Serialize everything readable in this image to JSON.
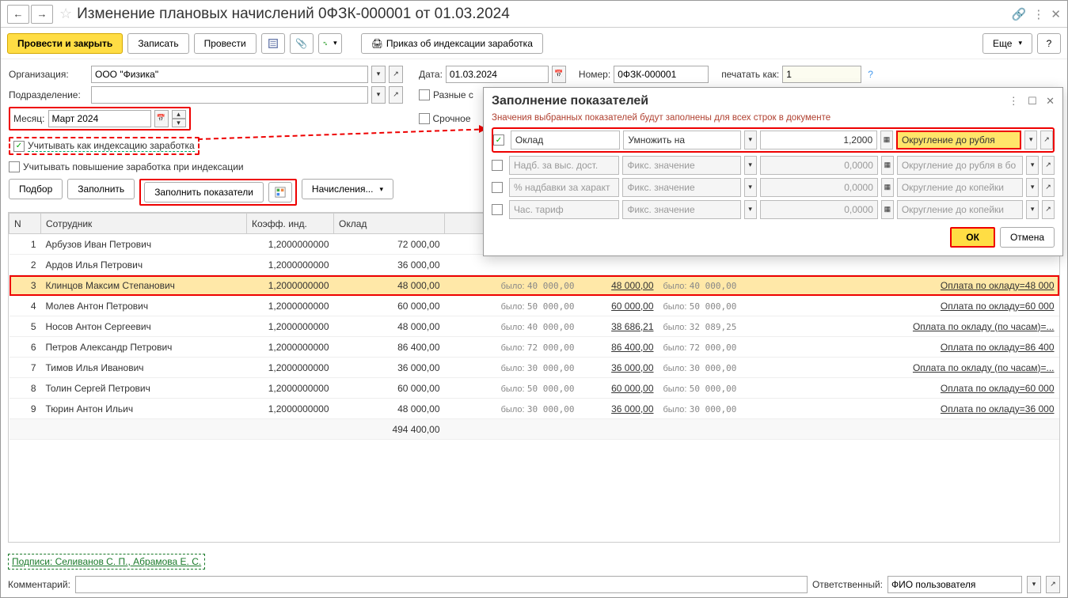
{
  "title": "Изменение плановых начислений 0ФЗК-000001 от 01.03.2024",
  "toolbar": {
    "post_close": "Провести и закрыть",
    "write": "Записать",
    "post": "Провести",
    "order": "Приказ об индексации заработка",
    "more": "Еще"
  },
  "form": {
    "org_label": "Организация:",
    "org_value": "ООО \"Физика\"",
    "date_label": "Дата:",
    "date_value": "01.03.2024",
    "number_label": "Номер:",
    "number_value": "0ФЗК-000001",
    "print_label": "печатать как:",
    "print_value": "1",
    "dept_label": "Подразделение:",
    "diff_label": "Разные с",
    "urgent_label": "Срочное",
    "month_label": "Месяц:",
    "month_value": "Март 2024",
    "index_check": "Учитывать как индексацию заработка",
    "raise_check": "Учитывать повышение заработка при индексации"
  },
  "buttons": {
    "pick": "Подбор",
    "fill": "Заполнить",
    "fill_metrics": "Заполнить показатели",
    "accruals": "Начисления..."
  },
  "table": {
    "headers": {
      "n": "N",
      "emp": "Сотрудник",
      "coef": "Коэфф. инд.",
      "salary": "Оклад"
    },
    "was": "было:",
    "rows": [
      {
        "n": "1",
        "emp": "Арбузов Иван Петрович",
        "coef": "1,2000000000",
        "salary": "72 000,00"
      },
      {
        "n": "2",
        "emp": "Ардов Илья Петрович",
        "coef": "1,2000000000",
        "salary": "36 000,00"
      },
      {
        "n": "3",
        "emp": "Клинцов Максим Степанович",
        "coef": "1,2000000000",
        "salary": "48 000,00",
        "was_s": "40 000,00",
        "new_s": "48 000,00",
        "was_f": "40 000,00",
        "pay": "Оплата по окладу=48 000"
      },
      {
        "n": "4",
        "emp": "Молев Антон Петрович",
        "coef": "1,2000000000",
        "salary": "60 000,00",
        "was_s": "50 000,00",
        "new_s": "60 000,00",
        "was_f": "50 000,00",
        "pay": "Оплата по окладу=60 000"
      },
      {
        "n": "5",
        "emp": "Носов Антон Сергеевич",
        "coef": "1,2000000000",
        "salary": "48 000,00",
        "was_s": "40 000,00",
        "new_s": "38 686,21",
        "was_f": "32 089,25",
        "pay": "Оплата по окладу (по часам)=..."
      },
      {
        "n": "6",
        "emp": "Петров Александр Петрович",
        "coef": "1,2000000000",
        "salary": "86 400,00",
        "was_s": "72 000,00",
        "new_s": "86 400,00",
        "was_f": "72 000,00",
        "pay": "Оплата по окладу=86 400"
      },
      {
        "n": "7",
        "emp": "Тимов Илья Иванович",
        "coef": "1,2000000000",
        "salary": "36 000,00",
        "was_s": "30 000,00",
        "new_s": "36 000,00",
        "was_f": "30 000,00",
        "pay": "Оплата по окладу (по часам)=..."
      },
      {
        "n": "8",
        "emp": "Толин Сергей Петрович",
        "coef": "1,2000000000",
        "salary": "60 000,00",
        "was_s": "50 000,00",
        "new_s": "60 000,00",
        "was_f": "50 000,00",
        "pay": "Оплата по окладу=60 000"
      },
      {
        "n": "9",
        "emp": "Тюрин Антон Ильич",
        "coef": "1,2000000000",
        "salary": "48 000,00",
        "was_s": "30 000,00",
        "new_s": "36 000,00",
        "was_f": "30 000,00",
        "pay": "Оплата по окладу=36 000"
      }
    ],
    "total": "494 400,00"
  },
  "popup": {
    "title": "Заполнение показателей",
    "sub": "Значения выбранных показателей будут заполнены для всех строк в документе",
    "rows": [
      {
        "checked": true,
        "name": "Оклад",
        "action": "Умножить на",
        "value": "1,2000",
        "round": "Округление до рубля",
        "active": true
      },
      {
        "checked": false,
        "name": "Надб. за выс. дост.",
        "action": "Фикс. значение",
        "value": "0,0000",
        "round": "Округление до рубля в бо",
        "active": false
      },
      {
        "checked": false,
        "name": "% надбавки за характ",
        "action": "Фикс. значение",
        "value": "0,0000",
        "round": "Округление до копейки",
        "active": false
      },
      {
        "checked": false,
        "name": "Час. тариф",
        "action": "Фикс. значение",
        "value": "0,0000",
        "round": "Округление до копейки",
        "active": false
      }
    ],
    "ok": "ОК",
    "cancel": "Отмена"
  },
  "bottom": {
    "sign": "Подписи: Селиванов С. П., Абрамова Е. С.",
    "comment_label": "Комментарий:",
    "resp_label": "Ответственный:",
    "resp_value": "ФИО пользователя"
  }
}
